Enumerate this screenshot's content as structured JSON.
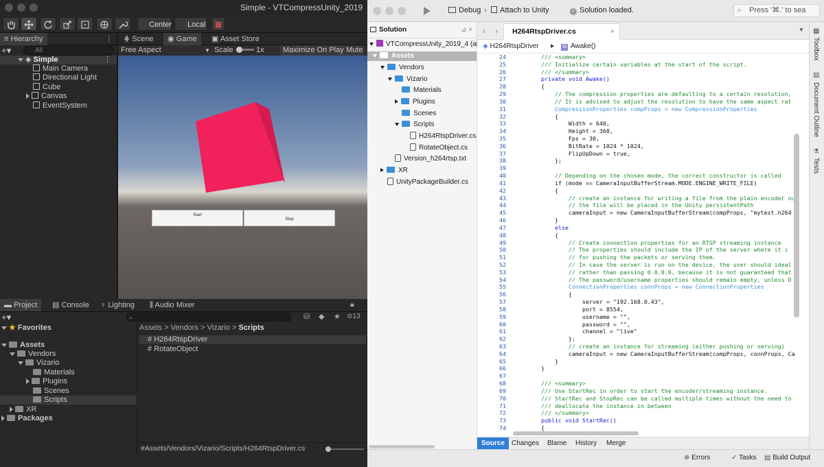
{
  "unity": {
    "window_title": "Simple - VTCompressUnity_2019",
    "toolbar": {
      "center": "Center",
      "local": "Local"
    },
    "hierarchy": {
      "tab": "Hierarchy",
      "search_placeholder": "All",
      "scene": "Simple",
      "items": [
        "Main Camera",
        "Directional Light",
        "Cube",
        "Canvas",
        "EventSystem"
      ]
    },
    "scene_tabs": {
      "scene": "Scene",
      "game": "Game",
      "asset_store": "Asset Store"
    },
    "game_bar": {
      "aspect": "Free Aspect",
      "scale_label": "Scale",
      "scale_value": "1x",
      "maximize": "Maximize On Play",
      "mute": "Mute"
    },
    "game_view": {
      "start": "Start",
      "stop": "Stop"
    },
    "bottom_tabs": {
      "project": "Project",
      "console": "Console",
      "lighting": "Lighting",
      "audio_mixer": "Audio Mixer"
    },
    "project": {
      "count": "13",
      "favorites": "Favorites",
      "tree": {
        "assets": "Assets",
        "vendors": "Vendors",
        "vizario": "Vizario",
        "materials": "Materials",
        "plugins": "Plugins",
        "scenes": "Scenes",
        "scripts": "Scripts",
        "xr": "XR",
        "packages": "Packages"
      },
      "breadcrumb": [
        "Assets",
        "Vendors",
        "Vizario",
        "Scripts"
      ],
      "files": [
        "H264RtspDriver",
        "RotateObject"
      ],
      "path": "Assets/Vendors/Vizario/Scripts/H264RtspDriver.cs"
    }
  },
  "vs": {
    "toolbar": {
      "config": "Debug",
      "target": "Attach to Unity",
      "status": "Solution loaded.",
      "search_placeholder": "Press '⌘.' to sea"
    },
    "solution": {
      "title": "Solution",
      "project": "VTCompressUnity_2019_4 (arth_",
      "items": {
        "assets": "Assets",
        "vendors": "Vendors",
        "vizario": "Vizario",
        "materials": "Materials",
        "plugins": "Plugins",
        "scenes": "Scenes",
        "scripts": "Scripts",
        "h264": "H264RtspDriver.cs",
        "rotate": "RotateObject.cs",
        "version": "Version_h264rtsp.txt",
        "xr": "XR",
        "builder": "UnityPackageBuilder.cs"
      }
    },
    "editor": {
      "tab": "H264RtspDriver.cs",
      "crumb_class": "H264RtspDriver",
      "crumb_method": "Awake()",
      "lines": [
        {
          "n": "24",
          "t": "        /// <summary>",
          "c": "cmt"
        },
        {
          "n": "25",
          "t": "        /// Initialize certain variables at the start of the script.",
          "c": "cmt"
        },
        {
          "n": "26",
          "t": "        /// </summary>",
          "c": "cmt"
        },
        {
          "n": "27",
          "t": "        private void Awake()",
          "c": "kw"
        },
        {
          "n": "28",
          "t": "        {",
          "c": ""
        },
        {
          "n": "29",
          "t": "            // The compression properties are defaulting to a certain resolution,",
          "c": "cmt"
        },
        {
          "n": "30",
          "t": "            // It is advised to adjust the resolution to have the same aspect rat",
          "c": "cmt"
        },
        {
          "n": "31",
          "t": "            CompressionProperties compProps = new CompressionProperties",
          "c": "ty"
        },
        {
          "n": "32",
          "t": "            {",
          "c": ""
        },
        {
          "n": "33",
          "t": "                Width = 640,",
          "c": ""
        },
        {
          "n": "34",
          "t": "                Height = 360,",
          "c": ""
        },
        {
          "n": "35",
          "t": "                Fps = 30,",
          "c": ""
        },
        {
          "n": "36",
          "t": "                BitRate = 1024 * 1024,",
          "c": ""
        },
        {
          "n": "37",
          "t": "                FlipUpDown = true,",
          "c": ""
        },
        {
          "n": "38",
          "t": "            };",
          "c": ""
        },
        {
          "n": "39",
          "t": "",
          "c": ""
        },
        {
          "n": "40",
          "t": "            // Depending on the chosen mode, the correct constructor is called",
          "c": "cmt"
        },
        {
          "n": "41",
          "t": "            if (mode == CameraInputBufferStream.MODE.ENGINE_WRITE_FILE)",
          "c": ""
        },
        {
          "n": "42",
          "t": "            {",
          "c": ""
        },
        {
          "n": "43",
          "t": "                // create an instance for writing a file from the plain encoder ou",
          "c": "cmt"
        },
        {
          "n": "44",
          "t": "                // the file will be placed in the Unity persistentPath",
          "c": "cmt"
        },
        {
          "n": "45",
          "t": "                cameraInput = new CameraInputBufferStream(compProps, \"mytest.h264",
          "c": ""
        },
        {
          "n": "46",
          "t": "            }",
          "c": ""
        },
        {
          "n": "47",
          "t": "            else",
          "c": "kw"
        },
        {
          "n": "48",
          "t": "            {",
          "c": ""
        },
        {
          "n": "49",
          "t": "                // Create connection properties for an RTSP streaming instance",
          "c": "cmt"
        },
        {
          "n": "50",
          "t": "                // The properties should include the IP of the server where it i",
          "c": "cmt"
        },
        {
          "n": "51",
          "t": "                // for pushing the packets or serving them.",
          "c": "cmt"
        },
        {
          "n": "52",
          "t": "                // In case the server is run on the device, the user should ideal",
          "c": "cmt"
        },
        {
          "n": "53",
          "t": "                // rather than passing 0.0.0.0, because it is not guaranteed that",
          "c": "cmt"
        },
        {
          "n": "54",
          "t": "                // The password/username properties should remain empty, unless D",
          "c": "cmt"
        },
        {
          "n": "55",
          "t": "                ConnectionProperties connProps = new ConnectionProperties",
          "c": "ty"
        },
        {
          "n": "56",
          "t": "                {",
          "c": ""
        },
        {
          "n": "57",
          "t": "                    server = \"192.168.0.43\",",
          "c": ""
        },
        {
          "n": "58",
          "t": "                    port = 8554,",
          "c": ""
        },
        {
          "n": "59",
          "t": "                    username = \"\",",
          "c": ""
        },
        {
          "n": "60",
          "t": "                    password = \"\",",
          "c": ""
        },
        {
          "n": "61",
          "t": "                    channel = \"live\"",
          "c": ""
        },
        {
          "n": "62",
          "t": "                };",
          "c": ""
        },
        {
          "n": "63",
          "t": "                // create an instance for streaming (either pushing or serving)",
          "c": "cmt"
        },
        {
          "n": "64",
          "t": "                cameraInput = new CameraInputBufferStream(compProps, connProps, Ca",
          "c": ""
        },
        {
          "n": "65",
          "t": "            }",
          "c": ""
        },
        {
          "n": "66",
          "t": "        }",
          "c": ""
        },
        {
          "n": "67",
          "t": "",
          "c": ""
        },
        {
          "n": "68",
          "t": "        /// <summary>",
          "c": "cmt"
        },
        {
          "n": "69",
          "t": "        /// Use StartRec in order to start the encoder/streaming instance.",
          "c": "cmt"
        },
        {
          "n": "70",
          "t": "        /// StartRec and StopRec can be called multiple times without the need to",
          "c": "cmt"
        },
        {
          "n": "71",
          "t": "        /// deallocate the instance in between",
          "c": "cmt"
        },
        {
          "n": "72",
          "t": "        /// </summary>",
          "c": "cmt"
        },
        {
          "n": "73",
          "t": "        public void StartRec()",
          "c": "kw"
        },
        {
          "n": "74",
          "t": "        {",
          "c": ""
        }
      ],
      "bottom_tabs": [
        "Source",
        "Changes",
        "Blame",
        "History",
        "Merge"
      ]
    },
    "right_tabs": [
      "Toolbox",
      "Document Outline",
      "Tests"
    ],
    "status": {
      "errors": "Errors",
      "tasks": "Tasks",
      "build": "Build Output"
    }
  }
}
